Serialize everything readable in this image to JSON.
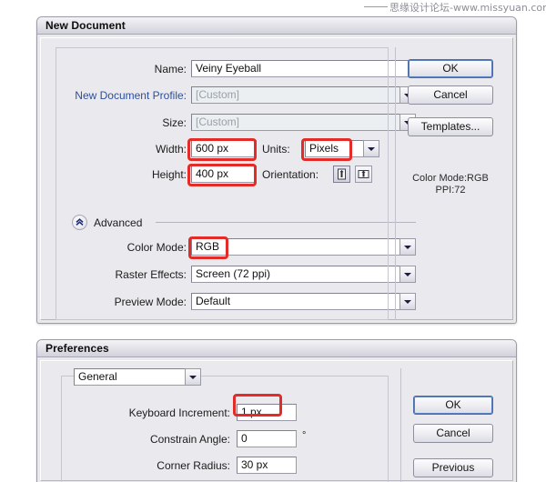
{
  "watermark": {
    "text": "思缘设计论坛-www.missyuan.com"
  },
  "new_document": {
    "title": "New Document",
    "fields": {
      "name_label": "Name:",
      "name_value": "Veiny Eyeball",
      "profile_label": "New Document Profile:",
      "profile_value": "[Custom]",
      "size_label": "Size:",
      "size_value": "[Custom]",
      "width_label": "Width:",
      "width_value": "600 px",
      "units_label": "Units:",
      "units_value": "Pixels",
      "height_label": "Height:",
      "height_value": "400 px",
      "orientation_label": "Orientation:",
      "advanced_label": "Advanced",
      "color_mode_label": "Color Mode:",
      "color_mode_value": "RGB",
      "raster_effects_label": "Raster Effects:",
      "raster_effects_value": "Screen (72 ppi)",
      "preview_mode_label": "Preview Mode:",
      "preview_mode_value": "Default"
    },
    "buttons": {
      "ok": "OK",
      "cancel": "Cancel",
      "templates": "Templates..."
    },
    "info": {
      "color_mode": "Color Mode:RGB",
      "ppi": "PPI:72"
    }
  },
  "preferences": {
    "title": "Preferences",
    "category_value": "General",
    "fields": {
      "keyboard_increment_label": "Keyboard Increment:",
      "keyboard_increment_value": "1 px",
      "constrain_angle_label": "Constrain Angle:",
      "constrain_angle_value": "0",
      "degree_symbol": "°",
      "corner_radius_label": "Corner Radius:",
      "corner_radius_value": "30 px"
    },
    "buttons": {
      "ok": "OK",
      "cancel": "Cancel",
      "previous": "Previous"
    }
  },
  "colors": {
    "annotation_red": "#e32b27",
    "link_blue": "#2b4f9e",
    "dialog_bg": "#eaeaee"
  }
}
